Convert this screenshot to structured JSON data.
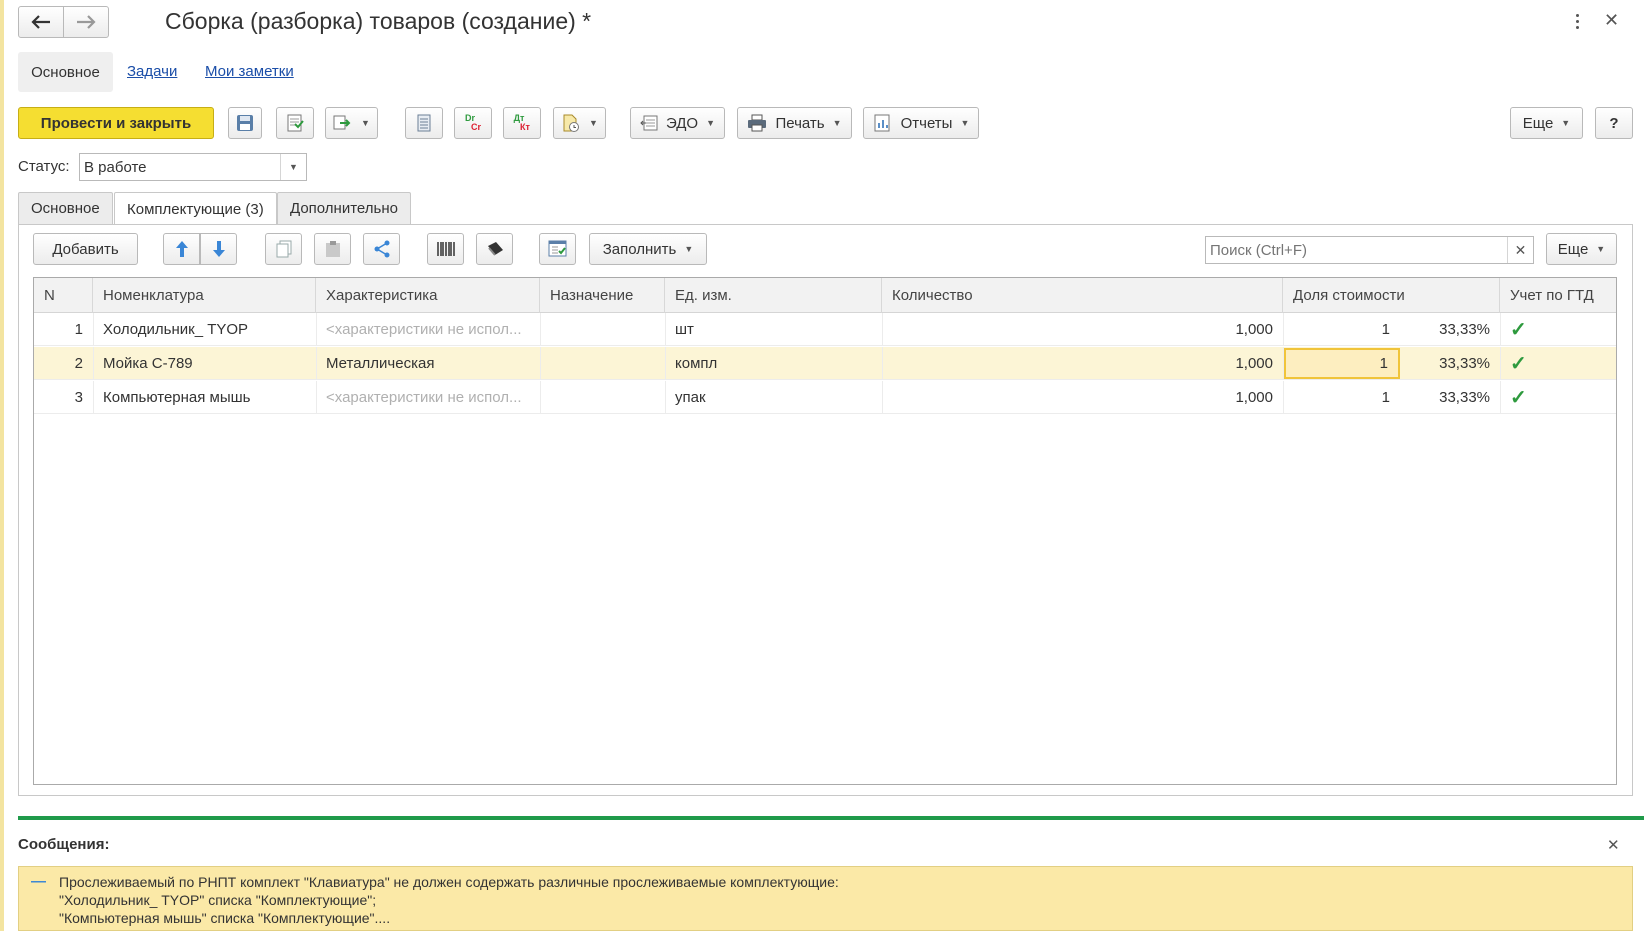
{
  "window": {
    "title": "Сборка (разборка) товаров (создание) *"
  },
  "nav_tabs": [
    {
      "label": "Основное"
    },
    {
      "label": "Задачи"
    },
    {
      "label": "Мои заметки"
    }
  ],
  "toolbar": {
    "post_close_label": "Провести и закрыть",
    "edo_label": "ЭДО",
    "print_label": "Печать",
    "reports_label": "Отчеты",
    "more_label": "Еще",
    "help_label": "?",
    "dr_cr_label_top": "Dr",
    "dr_cr_label_bottom": "Cr",
    "dt_kt_label_top": "Дт",
    "dt_kt_label_bottom": "Кт"
  },
  "status": {
    "label": "Статус:",
    "value": "В работе"
  },
  "doc_tabs": [
    {
      "label": "Основное"
    },
    {
      "label": "Комплектующие (3)"
    },
    {
      "label": "Дополнительно"
    }
  ],
  "table_toolbar": {
    "add_label": "Добавить",
    "fill_label": "Заполнить",
    "search_placeholder": "Поиск (Ctrl+F)",
    "more_label": "Еще"
  },
  "table": {
    "columns": [
      "N",
      "Номенклатура",
      "Характеристика",
      "Назначение",
      "Ед. изм.",
      "Количество",
      "Доля стоимости",
      "Учет по ГТД"
    ],
    "rows": [
      {
        "n": "1",
        "item": "Холодильник_ TYOP",
        "characteristic": "<характеристики не испол...",
        "purpose": "",
        "unit": "шт",
        "qty": "1,000",
        "share": "1",
        "share_pct": "33,33%",
        "gtd": "✓"
      },
      {
        "n": "2",
        "item": "Мойка С-789",
        "characteristic": "Металлическая",
        "purpose": "",
        "unit": "компл",
        "qty": "1,000",
        "share": "1",
        "share_pct": "33,33%",
        "gtd": "✓"
      },
      {
        "n": "3",
        "item": "Компьютерная мышь",
        "characteristic": "<характеристики не испол...",
        "purpose": "",
        "unit": "упак",
        "qty": "1,000",
        "share": "1",
        "share_pct": "33,33%",
        "gtd": "✓"
      }
    ]
  },
  "messages": {
    "title": "Сообщения:",
    "bullet": "—",
    "line1": "Прослеживаемый по РНПТ комплект \"Клавиатура\" не должен содержать различные прослеживаемые комплектующие:",
    "line2": "\"Холодильник_ TYOP\" списка \"Комплектующие\";",
    "line3": "\"Компьютерная мышь\" списка \"Комплектующие\"...."
  },
  "colors": {
    "accent_yellow": "#f5de31",
    "selected_row": "#fcf5d6",
    "message_bg": "#fbe9a7",
    "divider_green": "#1f9a4a",
    "check_green": "#2e9a3e"
  }
}
